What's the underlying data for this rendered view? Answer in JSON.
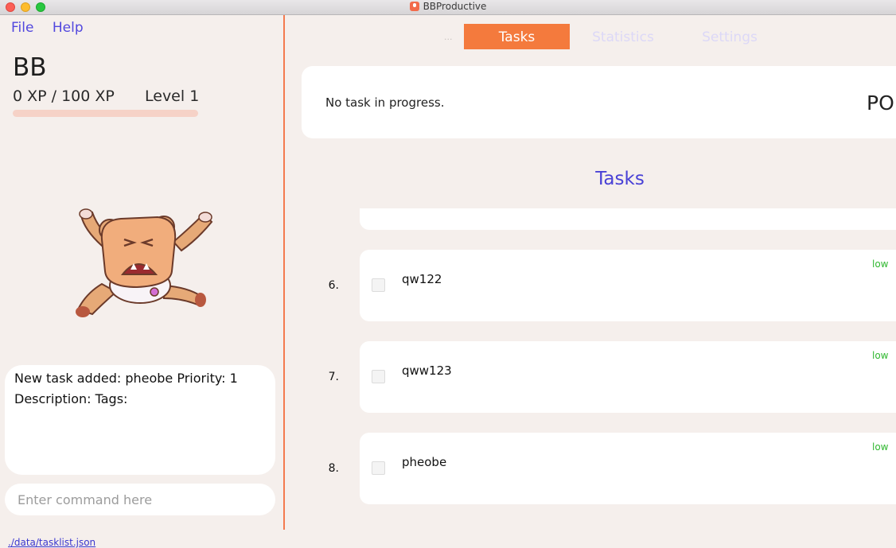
{
  "window": {
    "title": "BBProductive"
  },
  "menu": {
    "file": "File",
    "help": "Help"
  },
  "user": {
    "name": "BB",
    "xp": "0 XP / 100 XP",
    "level": "Level 1",
    "xp_progress": 0
  },
  "result": {
    "line1": "New task added: pheobe Priority: 1",
    "line2": "Description:  Tags:"
  },
  "command": {
    "placeholder": "Enter command here"
  },
  "status": {
    "path": "./data/tasklist.json"
  },
  "tabs": [
    {
      "label": "Tasks",
      "active": true
    },
    {
      "label": "Statistics",
      "active": false
    },
    {
      "label": "Settings",
      "active": false
    }
  ],
  "tabs_overflow": "...",
  "progress": {
    "text": "No task in progress.",
    "pomodoro_label": "PO"
  },
  "task_list": {
    "title": "Tasks",
    "items": [
      {
        "index": "6.",
        "name": "qw122",
        "priority": "low"
      },
      {
        "index": "7.",
        "name": "qww123",
        "priority": "low"
      },
      {
        "index": "8.",
        "name": "pheobe",
        "priority": "low"
      }
    ]
  },
  "colors": {
    "accent": "#f47a3d",
    "divider": "#f47a4f",
    "link": "#5147de",
    "priority_low": "#30b830",
    "background": "#f5efec"
  }
}
